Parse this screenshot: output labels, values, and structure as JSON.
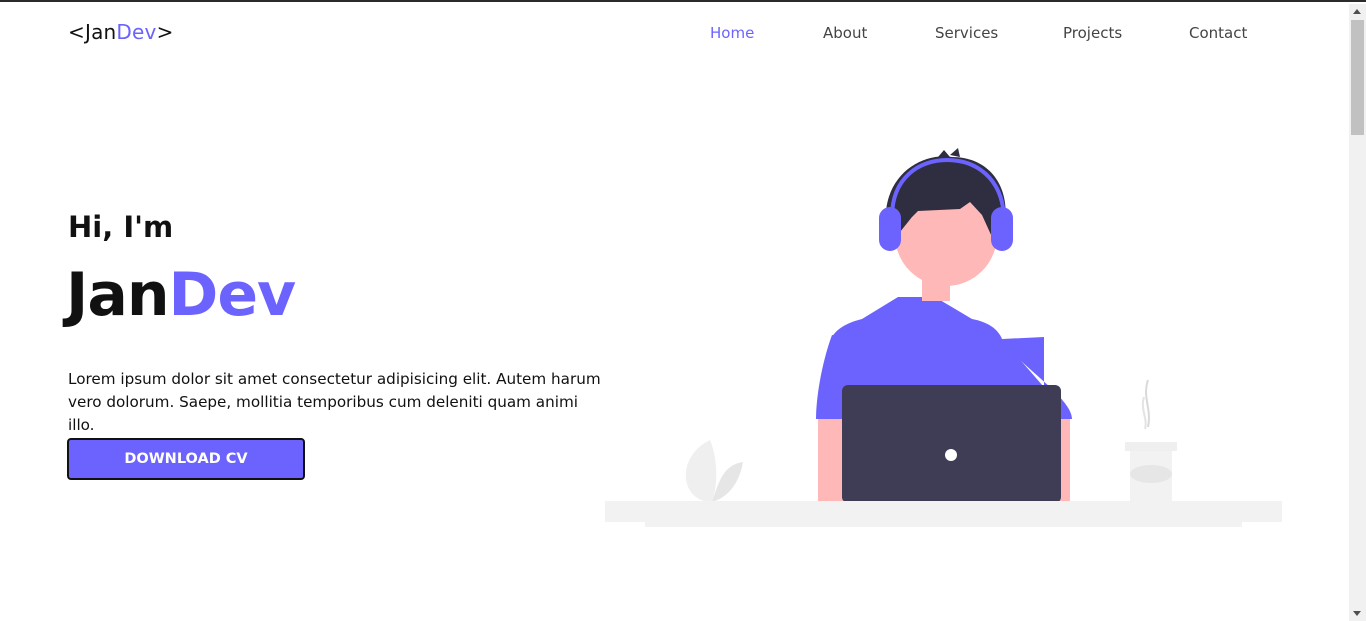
{
  "header": {
    "logo": {
      "open": "<",
      "part1": "Jan",
      "part2": "Dev",
      "close": ">"
    },
    "nav": [
      {
        "label": "Home",
        "active": true
      },
      {
        "label": "About",
        "active": false
      },
      {
        "label": "Services",
        "active": false
      },
      {
        "label": "Projects",
        "active": false
      },
      {
        "label": "Contact",
        "active": false
      }
    ]
  },
  "hero": {
    "greeting": "Hi, I'm",
    "name_part1": "Jan",
    "name_part2": "Dev",
    "description": "Lorem ipsum dolor sit amet consectetur adipisicing elit. Autem harum vero dolorum. Saepe, mollitia temporibus cum deleniti quam animi illo.",
    "cta_label": "DOWNLOAD CV"
  },
  "colors": {
    "accent": "#6c63ff",
    "text": "#111111",
    "skin": "#ffb8b8",
    "hair": "#2f2e41",
    "laptop": "#3f3d56",
    "desk": "#f2f2f2"
  },
  "illustration": {
    "subject": "developer-with-headphones-at-laptop",
    "icons": [
      "headphones-icon",
      "laptop-icon",
      "coffee-cup-icon",
      "plant-icon"
    ]
  }
}
